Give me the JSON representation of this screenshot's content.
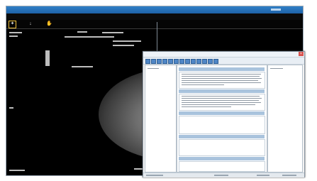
{
  "app": {
    "name": "  ",
    "title": " "
  },
  "menus": [
    " ",
    " ",
    " ",
    " "
  ],
  "tools": [
    {
      "icon": "select-tool-icon",
      "glyph": "✦",
      "active": true
    },
    {
      "icon": "window-level-icon",
      "glyph": "↓"
    },
    {
      "icon": "pan-tool-icon",
      "glyph": "✋"
    }
  ],
  "dialog": {
    "close_glyph": "×",
    "sections": [
      " ",
      " ",
      " ",
      " ",
      " "
    ]
  },
  "colors": {
    "titlebar": "#1f63a8",
    "section_header": "#a9c3dd",
    "dialog_bg": "#f3f3f3",
    "active_tool_border": "#f0c23a",
    "close_button": "#d9534f"
  }
}
